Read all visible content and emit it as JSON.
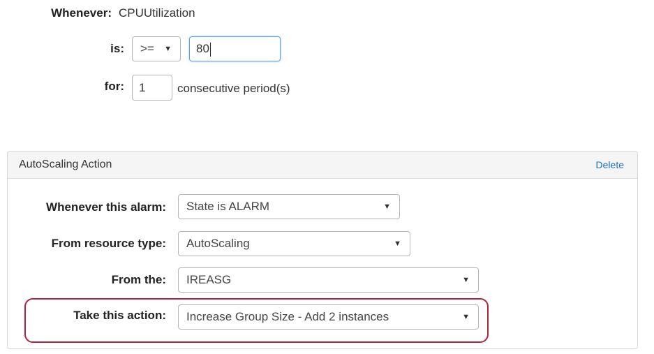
{
  "condition": {
    "whenever_label": "Whenever:",
    "metric": "CPUUtilization",
    "is_label": "is:",
    "operator": ">=",
    "threshold": "80",
    "for_label": "for:",
    "periods": "1",
    "periods_suffix": "consecutive period(s)"
  },
  "action_panel": {
    "title": "AutoScaling Action",
    "delete_label": "Delete",
    "rows": [
      {
        "label": "Whenever this alarm:",
        "value": "State is ALARM"
      },
      {
        "label": "From resource type:",
        "value": "AutoScaling"
      },
      {
        "label": "From the:",
        "value": "IREASG"
      },
      {
        "label": "Take this action:",
        "value": "Increase Group Size - Add 2 instances"
      }
    ]
  },
  "colors": {
    "highlight": "#b0233a",
    "link": "#1a6fb8",
    "focus": "#5da3e0"
  },
  "icons": {
    "caret": "chevron-down-icon"
  }
}
